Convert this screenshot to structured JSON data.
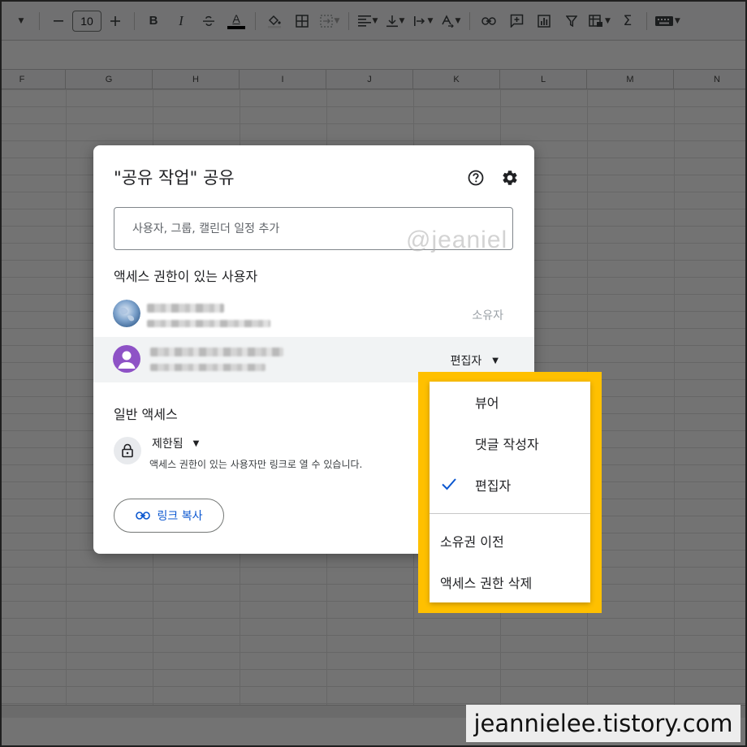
{
  "toolbar": {
    "font_size": "10",
    "bold_label": "B",
    "italic_label": "I",
    "text_color_label": "A",
    "sum_label": "Σ"
  },
  "columns": [
    "F",
    "G",
    "H",
    "I",
    "J",
    "K",
    "L",
    "M",
    "N"
  ],
  "dialog": {
    "title": "\"공유 작업\" 공유",
    "help_icon": "help-circle-icon",
    "settings_icon": "gear-icon",
    "add_people_placeholder": "사용자, 그룹, 캘린더 일정 추가",
    "watermark": "@jeaniel",
    "people_heading": "액세스 권한이 있는 사용자",
    "people": [
      {
        "role": "소유자"
      },
      {
        "role": "편집자"
      }
    ],
    "general_access_heading": "일반 액세스",
    "general_access_value": "제한됨",
    "general_access_desc": "액세스 권한이 있는 사용자만 링크로 열 수 있습니다.",
    "copy_link_label": "링크 복사"
  },
  "role_menu": {
    "items": [
      {
        "label": "뷰어",
        "checked": false
      },
      {
        "label": "댓글 작성자",
        "checked": false
      },
      {
        "label": "편집자",
        "checked": true
      }
    ],
    "actions": [
      {
        "label": "소유권 이전"
      },
      {
        "label": "액세스 권한 삭제"
      }
    ],
    "highlight_color": "#ffc000",
    "check_color": "#0b57d0"
  },
  "blog_mark": "jeannielee.tistory.com"
}
